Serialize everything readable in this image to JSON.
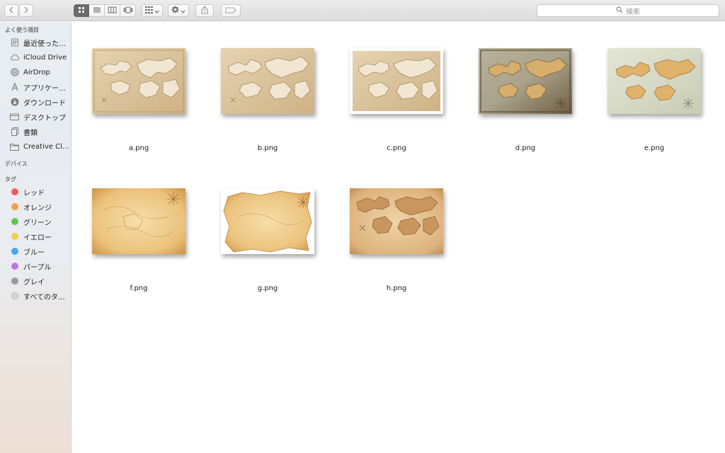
{
  "toolbar": {
    "back_icon": "chevron-left-icon",
    "forward_icon": "chevron-right-icon",
    "view_modes": [
      "icon-view-icon",
      "list-view-icon",
      "column-view-icon",
      "cover-flow-icon"
    ],
    "search_placeholder": "検索"
  },
  "sidebar": {
    "favorites_header": "よく使う項目",
    "favorites": [
      {
        "label": "最近使った…",
        "icon": "recents-icon"
      },
      {
        "label": "iCloud Drive",
        "icon": "cloud-icon"
      },
      {
        "label": "AirDrop",
        "icon": "airdrop-icon"
      },
      {
        "label": "アプリケー…",
        "icon": "applications-icon"
      },
      {
        "label": "ダウンロード",
        "icon": "downloads-icon"
      },
      {
        "label": "デスクトップ",
        "icon": "desktop-icon"
      },
      {
        "label": "書類",
        "icon": "documents-icon"
      },
      {
        "label": "Creative Cl…",
        "icon": "folder-icon"
      }
    ],
    "devices_header": "デバイス",
    "tags_header": "タグ",
    "tags": [
      {
        "label": "レッド",
        "color": "#f25b5b"
      },
      {
        "label": "オレンジ",
        "color": "#f0a046"
      },
      {
        "label": "グリーン",
        "color": "#5fc94f"
      },
      {
        "label": "イエロー",
        "color": "#f3cd45"
      },
      {
        "label": "ブルー",
        "color": "#46a8f1"
      },
      {
        "label": "パープル",
        "color": "#c373dd"
      },
      {
        "label": "グレイ",
        "color": "#9a9a9a"
      },
      {
        "label": "すべてのタ…",
        "color": "#cfcfcf"
      }
    ]
  },
  "files": [
    {
      "name": "a.png",
      "style": "light-parchment-map"
    },
    {
      "name": "b.png",
      "style": "light-parchment-map"
    },
    {
      "name": "c.png",
      "style": "light-parchment-map-white-border"
    },
    {
      "name": "d.png",
      "style": "dark-grunge-map"
    },
    {
      "name": "e.png",
      "style": "pale-green-map"
    },
    {
      "name": "f.png",
      "style": "aged-orange-parchment"
    },
    {
      "name": "g.png",
      "style": "torn-parchment-white-bg"
    },
    {
      "name": "h.png",
      "style": "orange-parchment-map"
    }
  ],
  "colors": {
    "sidebar_top": "#e8edf3",
    "sidebar_bottom": "#ecdfd6",
    "toolbar": "#e4e4e4",
    "active_segment": "#6b6b6b"
  }
}
